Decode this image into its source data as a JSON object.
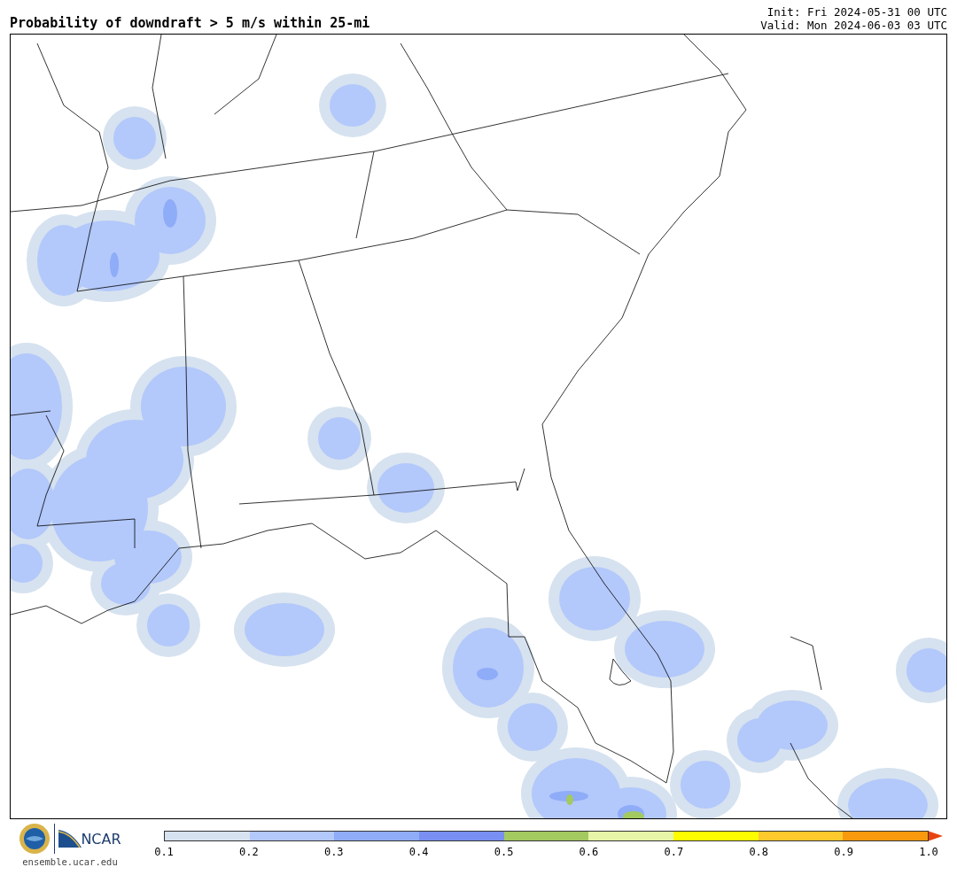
{
  "header": {
    "title": "Probability of downdraft > 5 m/s within 25-mi",
    "init": "Init: Fri 2024-05-31 00 UTC",
    "valid": "Valid: Mon 2024-06-03 03 UTC"
  },
  "footer": {
    "logo_text": "NCAR",
    "url": "ensemble.ucar.edu"
  },
  "colorbar": {
    "segments": [
      {
        "color": "#d6e2ef"
      },
      {
        "color": "#b3c8fb"
      },
      {
        "color": "#8eacf7"
      },
      {
        "color": "#7990f2"
      },
      {
        "color": "#a3c961"
      },
      {
        "color": "#e6f5a8"
      },
      {
        "color": "#fdfd00"
      },
      {
        "color": "#fdc92c"
      },
      {
        "color": "#f99a0e"
      }
    ],
    "extend": {
      "color": "#e8430e"
    },
    "ticks": [
      "0.1",
      "0.2",
      "0.3",
      "0.4",
      "0.5",
      "0.6",
      "0.7",
      "0.8",
      "0.9",
      "1.0"
    ]
  }
}
